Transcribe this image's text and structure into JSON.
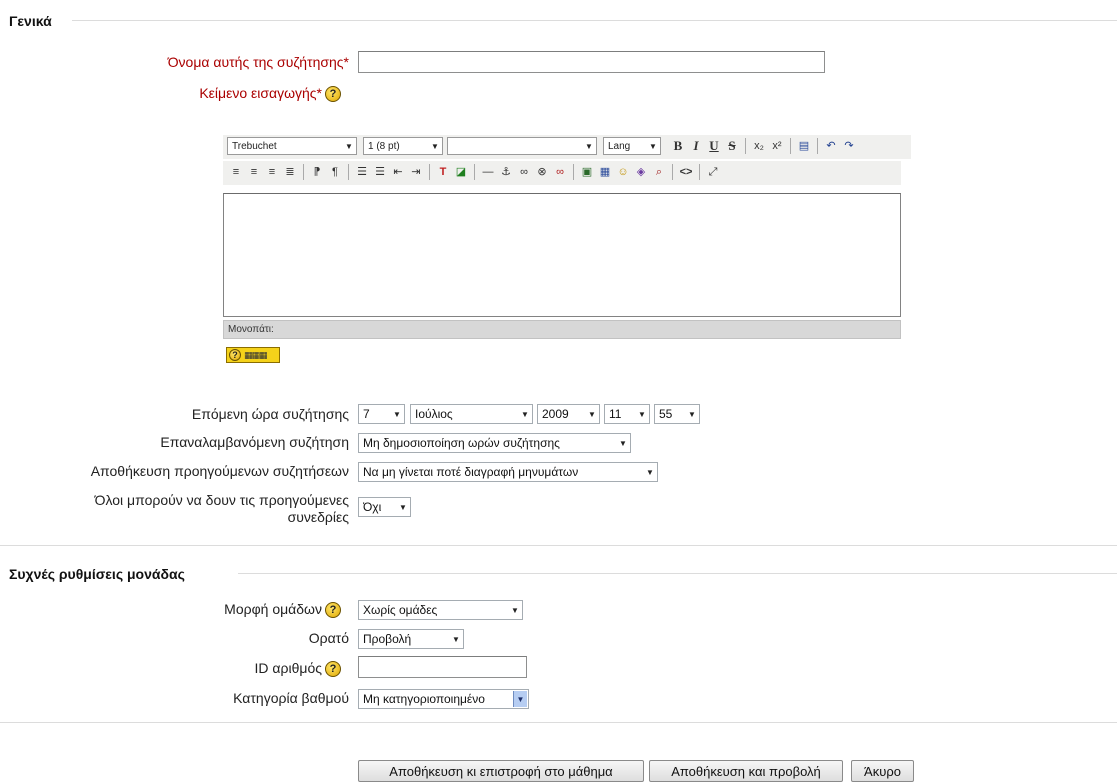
{
  "general": {
    "legend": "Γενικά",
    "name_label": "Όνομα αυτής της συζήτησης*",
    "name_value": "",
    "intro_label": "Κείμενο εισαγωγής*",
    "help_glyph": "?"
  },
  "editor": {
    "font_family": "Trebuchet",
    "font_size": "1 (8 pt)",
    "format": "",
    "lang": "Lang",
    "path_label": "Μονοπάτι:",
    "keyboard_help_glyph": "?",
    "toolbar_row1": [
      "bold-icon",
      "italic-icon",
      "underline-icon",
      "strikethrough-icon",
      "subscript-icon",
      "superscript-icon",
      "paste-word-icon",
      "undo-icon",
      "redo-icon"
    ],
    "toolbar_row2": [
      "align-left-icon",
      "align-center-icon",
      "align-right-icon",
      "justify-icon",
      "ltr-icon",
      "rtl-icon",
      "ordered-list-icon",
      "unordered-list-icon",
      "outdent-icon",
      "indent-icon",
      "text-color-icon",
      "background-color-icon",
      "horizontal-rule-icon",
      "anchor-icon",
      "link-icon",
      "unlink-icon",
      "nolink-icon",
      "image-icon",
      "table-icon",
      "smiley-icon",
      "special-char-icon",
      "search-replace-icon",
      "html-source-icon",
      "fullscreen-icon"
    ]
  },
  "chat_time": {
    "label": "Επόμενη ώρα συζήτησης",
    "day": "7",
    "month": "Ιούλιος",
    "year": "2009",
    "hour": "11",
    "minute": "55"
  },
  "repeat": {
    "label": "Επαναλαμβανόμενη συζήτηση",
    "value": "Μη δημοσιοποίηση ωρών συζήτησης"
  },
  "keep_days": {
    "label": "Αποθήκευση προηγούμενων συζητήσεων",
    "value": "Να μη γίνεται ποτέ διαγραφή μηνυμάτων"
  },
  "students_view": {
    "label_line1": "Όλοι μπορούν να δουν τις προηγούμενες",
    "label_line2": "συνεδρίες",
    "value": "Όχι"
  },
  "common": {
    "legend": "Συχνές ρυθμίσεις μονάδας",
    "group_mode_label": "Μορφή ομάδων",
    "group_mode_value": "Χωρίς ομάδες",
    "visible_label": "Ορατό",
    "visible_value": "Προβολή",
    "id_label": "ID αριθμός",
    "id_value": "",
    "grade_cat_label": "Κατηγορία βαθμού",
    "grade_cat_value": "Μη κατηγοριοποιημένο"
  },
  "buttons": {
    "save_return": "Αποθήκευση κι επιστροφή στο μάθημα",
    "save_display": "Αποθήκευση και προβολή",
    "cancel": "Άκυρο"
  }
}
